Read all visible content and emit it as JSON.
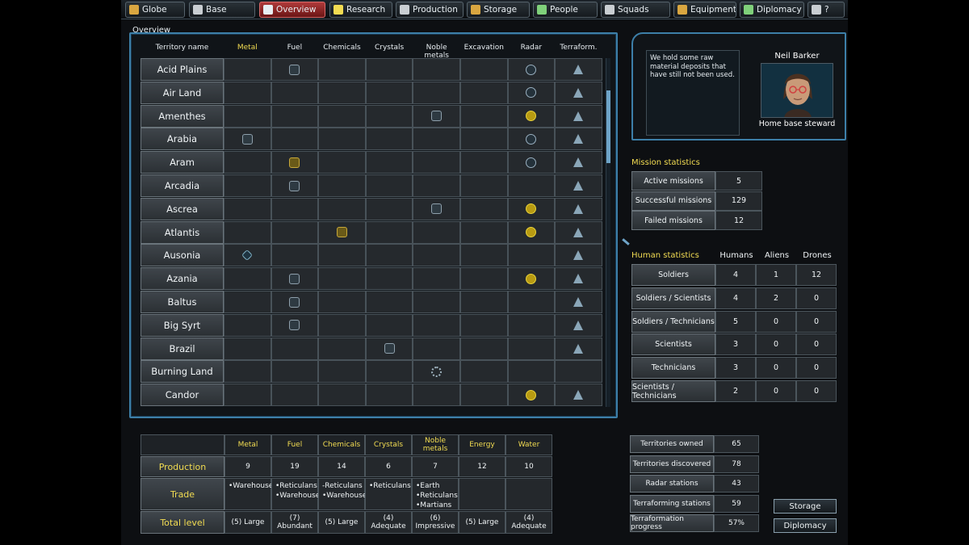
{
  "menu": [
    {
      "label": "Globe",
      "icon": "globe-icon",
      "color": "#d9a640",
      "active": false
    },
    {
      "label": "Base",
      "icon": "base-icon",
      "color": "#c9ced2",
      "active": false
    },
    {
      "label": "Overview",
      "icon": "overview-icon",
      "color": "#e8eef2",
      "active": true
    },
    {
      "label": "Research",
      "icon": "research-icon",
      "color": "#f2dc52",
      "active": false
    },
    {
      "label": "Production",
      "icon": "production-icon",
      "color": "#c9ced2",
      "active": false
    },
    {
      "label": "Storage",
      "icon": "storage-icon",
      "color": "#d9a640",
      "active": false
    },
    {
      "label": "People",
      "icon": "people-icon",
      "color": "#7fd07a",
      "active": false
    },
    {
      "label": "Squads",
      "icon": "squads-icon",
      "color": "#c9ced2",
      "active": false
    },
    {
      "label": "Equipment",
      "icon": "equipment-icon",
      "color": "#d9a640",
      "active": false
    },
    {
      "label": "Diplomacy",
      "icon": "diplomacy-icon",
      "color": "#7fd07a",
      "active": false
    },
    {
      "label": "?",
      "icon": "help-icon",
      "color": "#c9ced2",
      "active": false
    }
  ],
  "overview": {
    "title": "Overview",
    "columns": [
      "Territory name",
      "Metal",
      "Fuel",
      "Chemicals",
      "Crystals",
      "Noble metals",
      "Excavation",
      "Radar",
      "Terraform."
    ],
    "rows": [
      {
        "name": "Acid Plains",
        "metal": "",
        "fuel": "silver",
        "chemicals": "",
        "crystals": "",
        "noble": "",
        "excavation": "",
        "radar": "grey",
        "terraform": "terra"
      },
      {
        "name": "Air Land",
        "metal": "",
        "fuel": "",
        "chemicals": "",
        "crystals": "",
        "noble": "",
        "excavation": "",
        "radar": "grey",
        "terraform": "terra"
      },
      {
        "name": "Amenthes",
        "metal": "",
        "fuel": "",
        "chemicals": "",
        "crystals": "",
        "noble": "silver",
        "excavation": "",
        "radar": "yellow",
        "terraform": "terra"
      },
      {
        "name": "Arabia",
        "metal": "silver",
        "fuel": "",
        "chemicals": "",
        "crystals": "",
        "noble": "",
        "excavation": "",
        "radar": "grey",
        "terraform": "terra"
      },
      {
        "name": "Aram",
        "metal": "",
        "fuel": "gold",
        "chemicals": "",
        "crystals": "",
        "noble": "",
        "excavation": "",
        "radar": "grey",
        "terraform": "terra"
      },
      {
        "name": "Arcadia",
        "metal": "",
        "fuel": "silver",
        "chemicals": "",
        "crystals": "",
        "noble": "",
        "excavation": "",
        "radar": "",
        "terraform": "terra"
      },
      {
        "name": "Ascrea",
        "metal": "",
        "fuel": "",
        "chemicals": "",
        "crystals": "",
        "noble": "silver",
        "excavation": "",
        "radar": "yellow",
        "terraform": "terra"
      },
      {
        "name": "Atlantis",
        "metal": "",
        "fuel": "",
        "chemicals": "gold",
        "crystals": "",
        "noble": "",
        "excavation": "",
        "radar": "yellow",
        "terraform": "terra"
      },
      {
        "name": "Ausonia",
        "metal": "gem",
        "fuel": "",
        "chemicals": "",
        "crystals": "",
        "noble": "",
        "excavation": "",
        "radar": "",
        "terraform": "terra"
      },
      {
        "name": "Azania",
        "metal": "",
        "fuel": "silver",
        "chemicals": "",
        "crystals": "",
        "noble": "",
        "excavation": "",
        "radar": "yellow",
        "terraform": "terra"
      },
      {
        "name": "Baltus",
        "metal": "",
        "fuel": "silver",
        "chemicals": "",
        "crystals": "",
        "noble": "",
        "excavation": "",
        "radar": "",
        "terraform": "terra"
      },
      {
        "name": "Big Syrt",
        "metal": "",
        "fuel": "silver",
        "chemicals": "",
        "crystals": "",
        "noble": "",
        "excavation": "",
        "radar": "",
        "terraform": "terra"
      },
      {
        "name": "Brazil",
        "metal": "",
        "fuel": "",
        "chemicals": "",
        "crystals": "silver",
        "noble": "",
        "excavation": "",
        "radar": "",
        "terraform": "terra"
      },
      {
        "name": "Burning Land",
        "metal": "",
        "fuel": "",
        "chemicals": "",
        "crystals": "",
        "noble": "gear",
        "excavation": "",
        "radar": "",
        "terraform": ""
      },
      {
        "name": "Candor",
        "metal": "",
        "fuel": "",
        "chemicals": "",
        "crystals": "",
        "noble": "",
        "excavation": "",
        "radar": "yellow",
        "terraform": "terra"
      }
    ]
  },
  "steward": {
    "message": "We hold some raw material deposits that have still not been used.",
    "name": "Neil Barker",
    "role": "Home base steward"
  },
  "mission_stats": {
    "title": "Mission statistics",
    "rows": [
      {
        "label": "Active missions",
        "value": "5"
      },
      {
        "label": "Successful missions",
        "value": "129"
      },
      {
        "label": "Failed missions",
        "value": "12"
      }
    ]
  },
  "human_stats": {
    "title": "Human statistics",
    "columns": [
      "Humans",
      "Aliens",
      "Drones"
    ],
    "rows": [
      {
        "label": "Soldiers",
        "values": [
          "4",
          "1",
          "12"
        ]
      },
      {
        "label": "Soldiers / Scientists",
        "values": [
          "4",
          "2",
          "0"
        ]
      },
      {
        "label": "Soldiers / Technicians",
        "values": [
          "5",
          "0",
          "0"
        ]
      },
      {
        "label": "Scientists",
        "values": [
          "3",
          "0",
          "0"
        ]
      },
      {
        "label": "Technicians",
        "values": [
          "3",
          "0",
          "0"
        ]
      },
      {
        "label": "Scientists / Technicians",
        "values": [
          "2",
          "0",
          "0"
        ]
      }
    ]
  },
  "production_table": {
    "columns": [
      "Metal",
      "Fuel",
      "Chemicals",
      "Crystals",
      "Noble metals",
      "Energy",
      "Water"
    ],
    "production_label": "Production",
    "production": [
      "9",
      "19",
      "14",
      "6",
      "7",
      "12",
      "10"
    ],
    "trade_label": "Trade",
    "trade": [
      [
        "•Warehouse"
      ],
      [
        "•Reticulans",
        "•Warehouse"
      ],
      [
        "-Reticulans",
        "•Warehouse"
      ],
      [
        "•Reticulans"
      ],
      [
        "•Earth",
        "•Reticulans",
        "•Martians"
      ],
      [],
      []
    ],
    "total_label": "Total level",
    "total": [
      "(5) Large",
      "(7) Abundant",
      "(5) Large",
      "(4) Adequate",
      "(6) Impressive",
      "(5) Large",
      "(4) Adequate"
    ]
  },
  "summary": [
    {
      "label": "Territories owned",
      "value": "65"
    },
    {
      "label": "Territories discovered",
      "value": "78"
    },
    {
      "label": "Radar stations",
      "value": "43"
    },
    {
      "label": "Terraforming stations",
      "value": "59"
    },
    {
      "label": "Terraformation progress",
      "value": "57%"
    }
  ],
  "buttons": {
    "storage": "Storage",
    "diplomacy": "Diplomacy"
  }
}
